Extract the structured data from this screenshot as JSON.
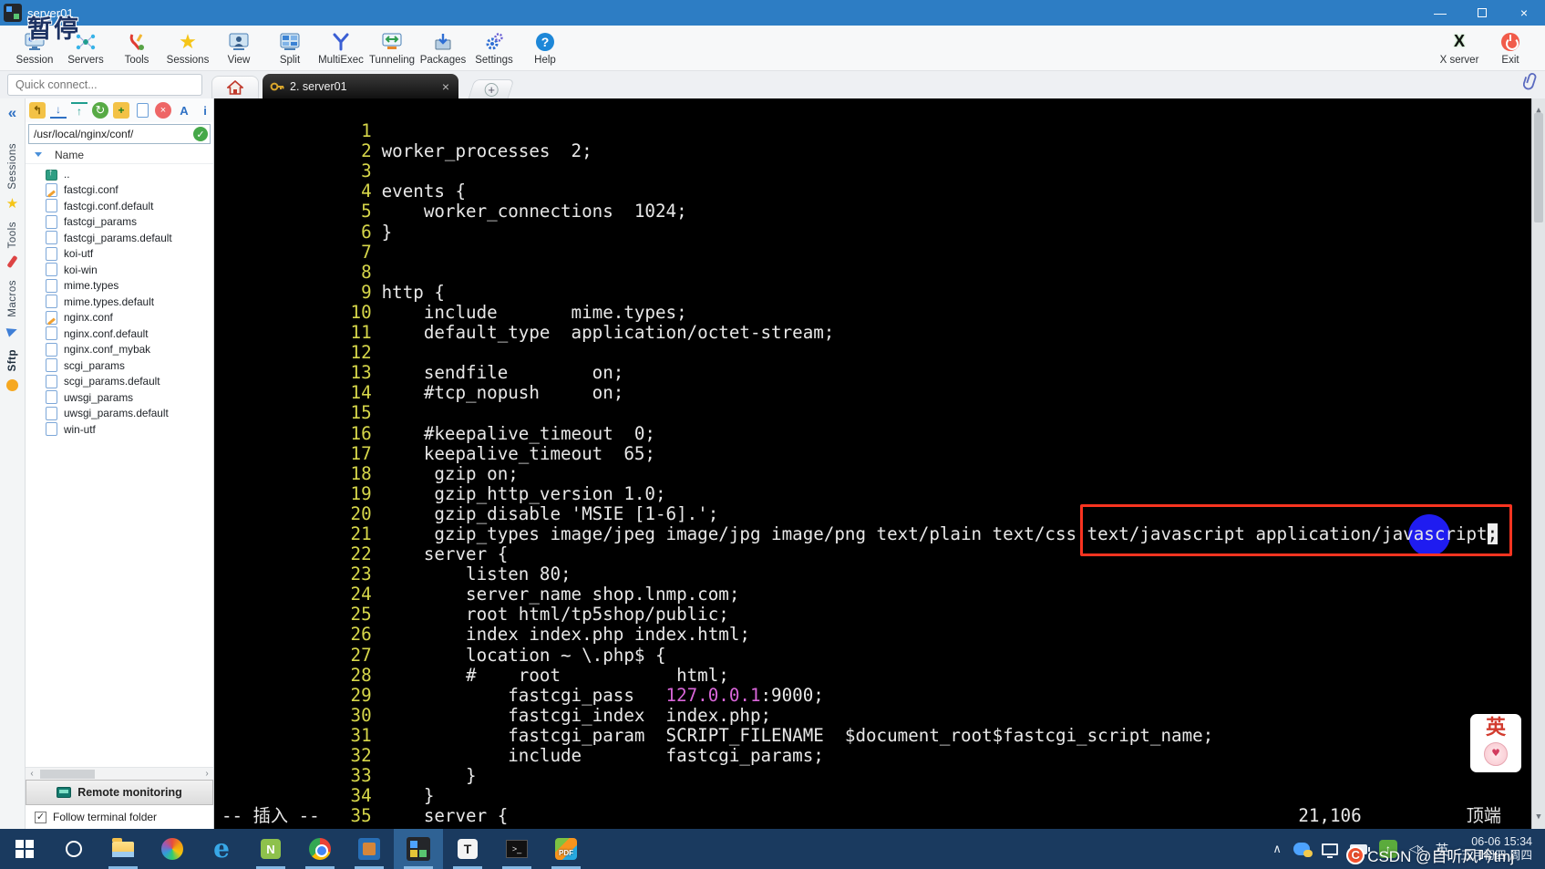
{
  "window": {
    "title": "server01",
    "pause_overlay": "暂停",
    "controls": {
      "minimize": "—",
      "maximize": "",
      "close": "×"
    }
  },
  "toolbar": {
    "items": [
      {
        "label": "Session"
      },
      {
        "label": "Servers"
      },
      {
        "label": "Tools"
      },
      {
        "label": "Sessions"
      },
      {
        "label": "View"
      },
      {
        "label": "Split"
      },
      {
        "label": "MultiExec"
      },
      {
        "label": "Tunneling"
      },
      {
        "label": "Packages"
      },
      {
        "label": "Settings"
      },
      {
        "label": "Help"
      }
    ],
    "xserver_label": "X server",
    "exit_label": "Exit"
  },
  "quick_connect": {
    "placeholder": "Quick connect..."
  },
  "tabs": {
    "active_label": "2. server01",
    "close_glyph": "×",
    "new_glyph": "+"
  },
  "side_strip": {
    "collapse_glyph": "«",
    "tabs": [
      "Sessions",
      "Tools",
      "Macros",
      "Sftp"
    ]
  },
  "sidebar": {
    "path": "/usr/local/nginx/conf/",
    "name_header": "Name",
    "files": [
      {
        "name": "..",
        "up": true
      },
      {
        "name": "fastcgi.conf",
        "edited": true
      },
      {
        "name": "fastcgi.conf.default"
      },
      {
        "name": "fastcgi_params"
      },
      {
        "name": "fastcgi_params.default"
      },
      {
        "name": "koi-utf"
      },
      {
        "name": "koi-win"
      },
      {
        "name": "mime.types"
      },
      {
        "name": "mime.types.default"
      },
      {
        "name": "nginx.conf",
        "edited": true
      },
      {
        "name": "nginx.conf.default"
      },
      {
        "name": "nginx.conf_mybak"
      },
      {
        "name": "scgi_params"
      },
      {
        "name": "scgi_params.default"
      },
      {
        "name": "uwsgi_params"
      },
      {
        "name": "uwsgi_params.default"
      },
      {
        "name": "win-utf"
      }
    ],
    "remote_monitoring_label": "Remote monitoring",
    "follow_label": "Follow terminal folder",
    "follow_checked": "✓"
  },
  "terminal": {
    "lines": [
      {
        "num": "1",
        "text": ""
      },
      {
        "num": "2",
        "text": "worker_processes  2;"
      },
      {
        "num": "3",
        "text": ""
      },
      {
        "num": "4",
        "text": "events {"
      },
      {
        "num": "5",
        "text": "    worker_connections  1024;"
      },
      {
        "num": "6",
        "text": "}"
      },
      {
        "num": "7",
        "text": ""
      },
      {
        "num": "8",
        "text": ""
      },
      {
        "num": "9",
        "text": "http {"
      },
      {
        "num": "10",
        "text": "    include       mime.types;"
      },
      {
        "num": "11",
        "text": "    default_type  application/octet-stream;"
      },
      {
        "num": "12",
        "text": ""
      },
      {
        "num": "13",
        "text": "    sendfile        on;"
      },
      {
        "num": "14",
        "text": "    #tcp_nopush     on;"
      },
      {
        "num": "15",
        "text": ""
      },
      {
        "num": "16",
        "text": "    #keepalive_timeout  0;"
      },
      {
        "num": "17",
        "text": "    keepalive_timeout  65;"
      },
      {
        "num": "18",
        "text": "     gzip on;"
      },
      {
        "num": "19",
        "text": "     gzip_http_version 1.0;"
      },
      {
        "num": "20",
        "text": "     gzip_disable 'MSIE [1-6].';"
      },
      {
        "num": "21",
        "text": "     gzip_types image/jpeg image/jpg image/png text/plain text/css ",
        "box": "text/javascript application/javascript",
        "cursor": ";"
      },
      {
        "num": "22",
        "text": "    server {"
      },
      {
        "num": "23",
        "text": "        listen 80;"
      },
      {
        "num": "24",
        "text": "        server_name shop.lnmp.com;"
      },
      {
        "num": "25",
        "text": "        root html/tp5shop/public;"
      },
      {
        "num": "26",
        "text": "        index index.php index.html;"
      },
      {
        "num": "27",
        "text": "        location ~ \\.php$ {"
      },
      {
        "num": "28",
        "text": "        #    root           html;"
      },
      {
        "num": "29",
        "text": "            fastcgi_pass   ",
        "magenta": "127.0.0.1",
        "text2": ":9000;"
      },
      {
        "num": "30",
        "text": "            fastcgi_index  index.php;"
      },
      {
        "num": "31",
        "text": "            fastcgi_param  SCRIPT_FILENAME  $document_root$fastcgi_script_name;"
      },
      {
        "num": "32",
        "text": "            include        fastcgi_params;"
      },
      {
        "num": "33",
        "text": "        }"
      },
      {
        "num": "34",
        "text": "    }"
      },
      {
        "num": "35",
        "text": "    server {"
      }
    ],
    "status_left": "-- 插入 --",
    "cursor_pos": "21,106",
    "position_label": "顶端"
  },
  "ime_badge": {
    "char": "英",
    "logo_glyph": "♥"
  },
  "taskbar": {
    "icon_glyphs": {
      "edge": "e",
      "npp": "N",
      "typora": "T",
      "cmd": ">_",
      "pdf": "PDF",
      "greenup": "↑",
      "mute": "◁×",
      "chevron": "∧"
    },
    "ime": "英",
    "clock_line1": "06-06 15:34",
    "clock_line2": "五月初四 周四",
    "watermark_logo": "C",
    "watermark": "CSDN @自听风吟tmj"
  }
}
